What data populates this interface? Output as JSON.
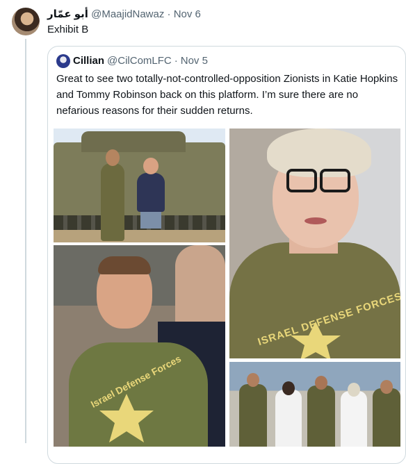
{
  "tweet": {
    "author_name": "أبو عمّار",
    "handle": "@MaajidNawaz",
    "separator": "·",
    "date": "Nov 6",
    "text": "Exhibit B"
  },
  "quote": {
    "author_name": "Cillian",
    "handle": "@CilComLFC",
    "separator": "·",
    "date": "Nov 5",
    "text": "Great to see two totally-not-controlled-opposition Zionists in Katie Hopkins and Tommy Robinson back on this platform. I’m sure there are no nefarious reasons for their sudden returns.",
    "photo_shirt_text": "ISRAEL DEFENSE FORCES",
    "photo_shirt_text_2": "Israel Defense Forces"
  },
  "colors": {
    "border": "#cfd9de",
    "muted_text": "#536471",
    "idf_olive": "#6e7842",
    "emblem_yellow": "#e9d77a"
  }
}
